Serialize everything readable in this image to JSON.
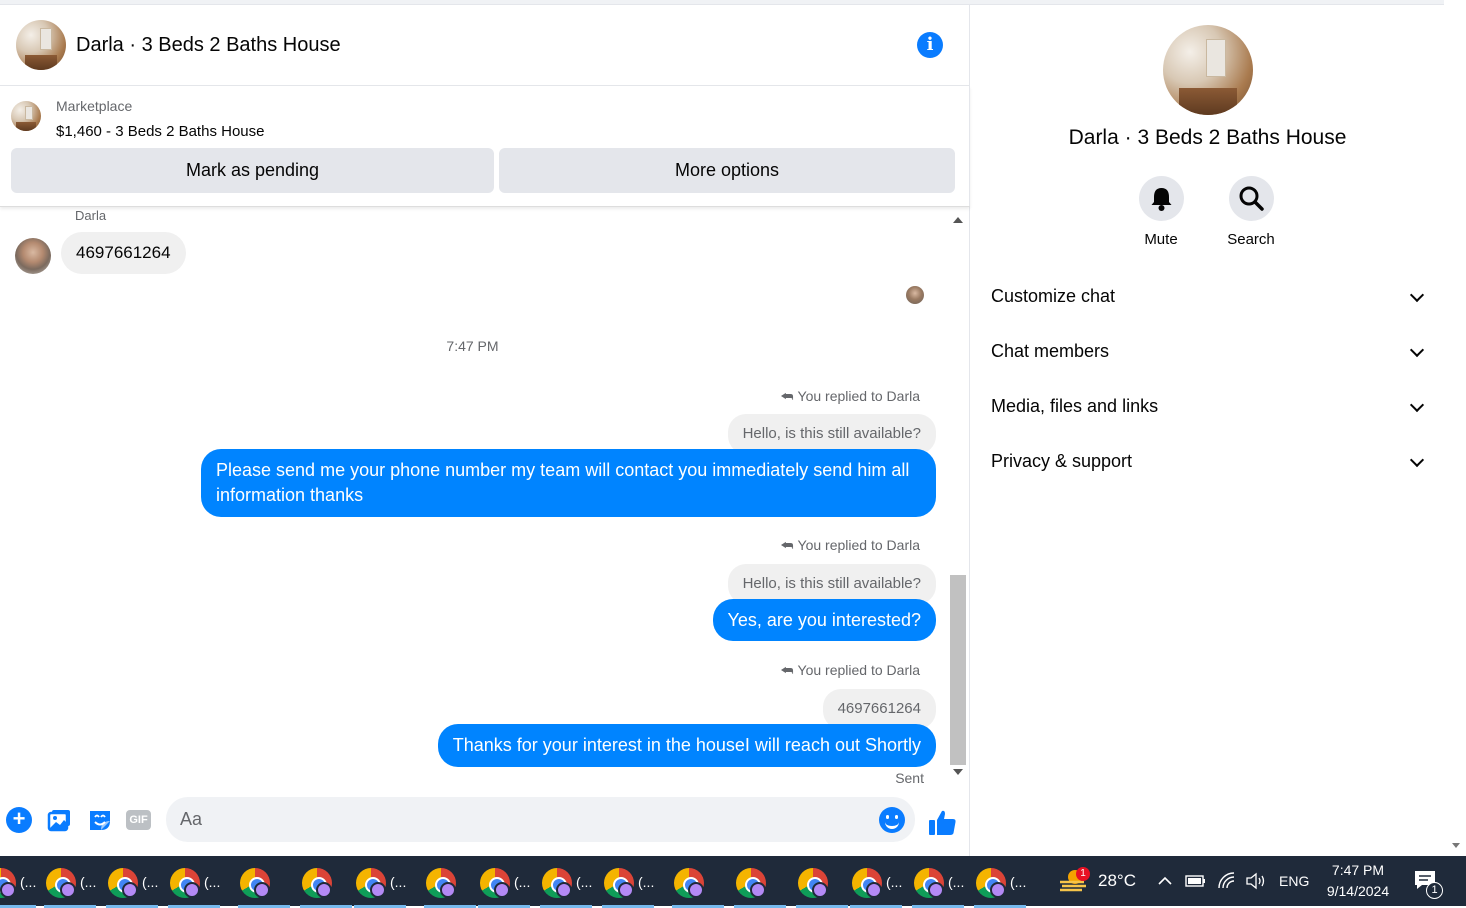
{
  "header": {
    "title": "Darla · 3 Beds 2 Baths House"
  },
  "marketplace": {
    "label": "Marketplace",
    "listing": "$1,460 - 3 Beds 2 Baths House",
    "pending_button": "Mark as pending",
    "more_button": "More options"
  },
  "conversation": {
    "sender_name": "Darla",
    "incoming": "4697661264",
    "timestamp": "7:47 PM",
    "reply_label": "You replied to Darla",
    "messages": [
      {
        "quote": "Hello, is this still available?",
        "text": "Please send me your phone number my team will contact you immediately send him all information thanks"
      },
      {
        "quote": "Hello, is this still available?",
        "text": "Yes, are you interested?"
      },
      {
        "quote": "4697661264",
        "text": "Thanks for your interest in the houseI will reach out Shortly"
      }
    ],
    "status": "Sent"
  },
  "composer": {
    "placeholder": "Aa",
    "gif_label": "GIF",
    "plus_label": "+"
  },
  "sidebar": {
    "title": "Darla · 3 Beds 2 Baths House",
    "mute_label": "Mute",
    "search_label": "Search",
    "sections": [
      "Customize chat",
      "Chat members",
      "Media, files and links",
      "Privacy & support"
    ]
  },
  "taskbar": {
    "app_label": "(...",
    "temperature": "28°C",
    "weather_badge": "1",
    "language": "ENG",
    "time": "7:47 PM",
    "date": "9/14/2024",
    "notification_count": "1"
  },
  "colors": {
    "messenger_blue": "#0084ff",
    "accent": "#0a7cff",
    "taskbar": "#1f2a3a"
  }
}
